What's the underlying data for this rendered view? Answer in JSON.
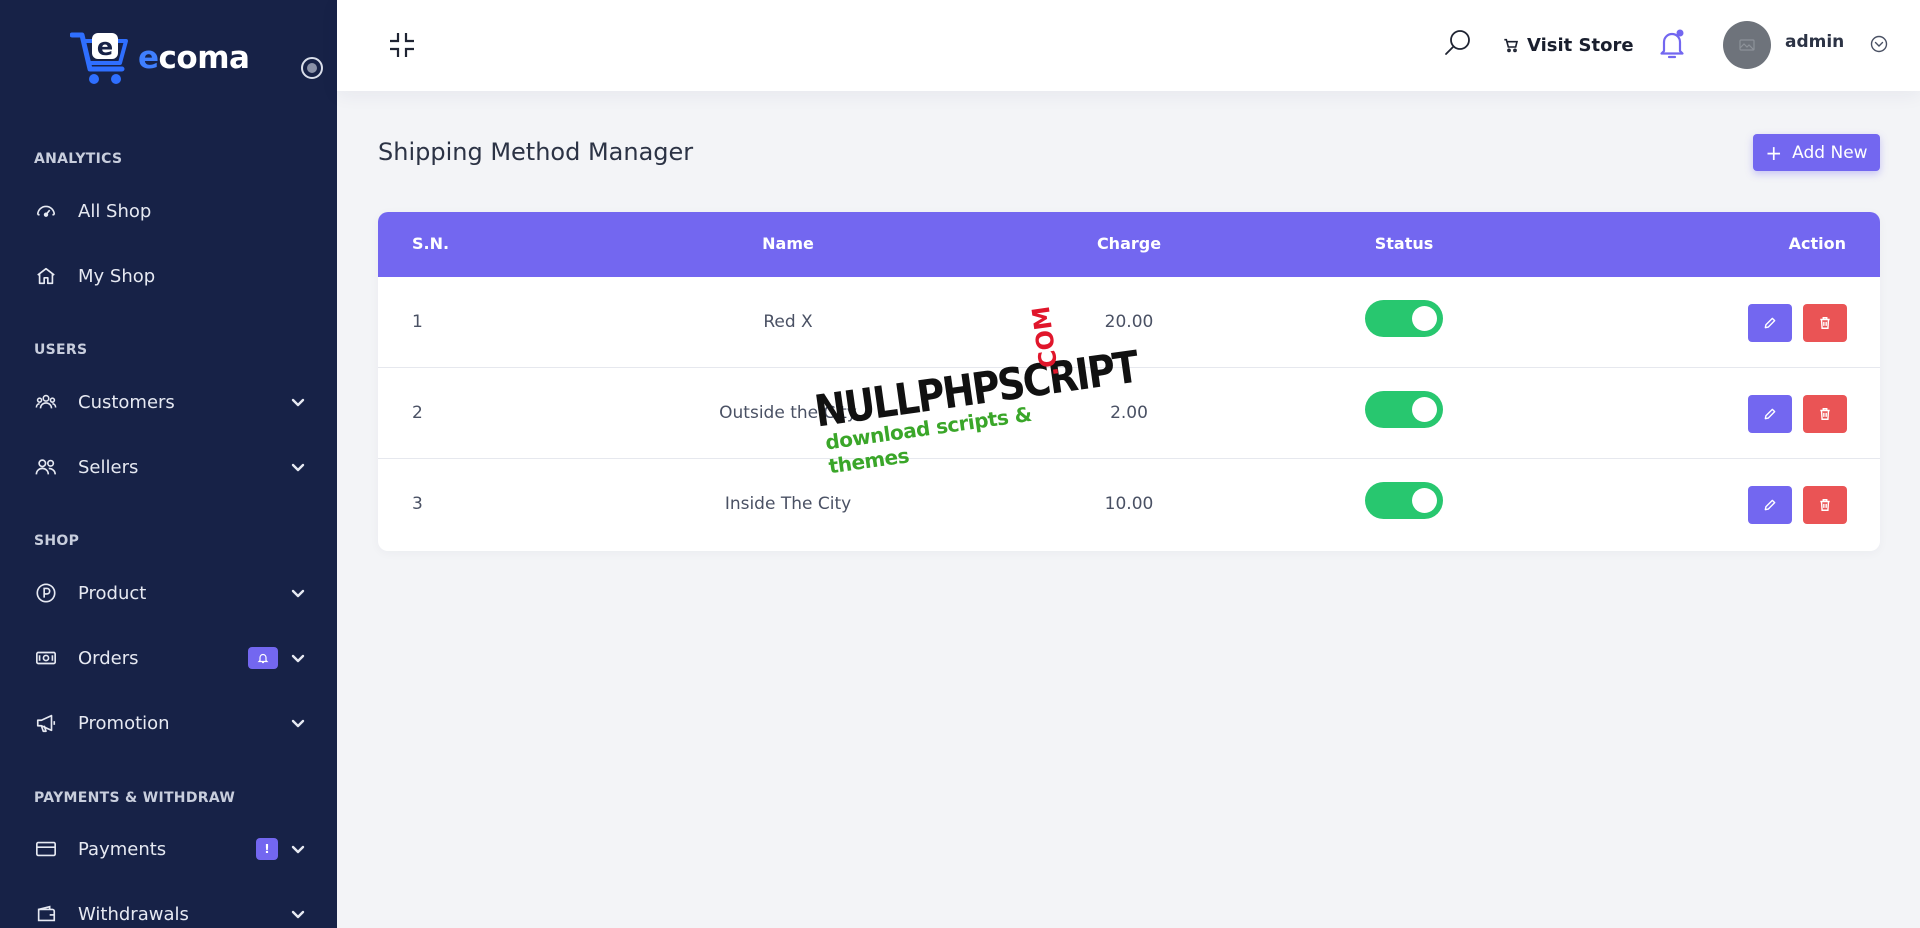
{
  "brand": {
    "logo_text_first": "e",
    "logo_text_rest": "coma",
    "cart_letter": "e"
  },
  "sidebar": {
    "sections": [
      {
        "title": "ANALYTICS"
      },
      {
        "title": "USERS"
      },
      {
        "title": "SHOP"
      },
      {
        "title": "PAYMENTS & WITHDRAW"
      }
    ],
    "items": [
      {
        "label": "All Shop",
        "icon": "dashboard-icon"
      },
      {
        "label": "My Shop",
        "icon": "home-icon"
      },
      {
        "label": "Customers",
        "icon": "users-group-icon"
      },
      {
        "label": "Sellers",
        "icon": "users-icon"
      },
      {
        "label": "Product",
        "icon": "product-icon"
      },
      {
        "label": "Orders",
        "icon": "money-icon",
        "badge": "bell"
      },
      {
        "label": "Promotion",
        "icon": "megaphone-icon"
      },
      {
        "label": "Payments",
        "icon": "card-icon",
        "badge": "!"
      },
      {
        "label": "Withdrawals",
        "icon": "wallet-icon"
      }
    ]
  },
  "header": {
    "visit_store": "Visit Store",
    "user_name": "admin"
  },
  "page": {
    "title": "Shipping Method Manager",
    "add_new": "Add New"
  },
  "table": {
    "columns": [
      "S.N.",
      "Name",
      "Charge",
      "Status",
      "Action"
    ],
    "rows": [
      {
        "sn": "1",
        "name": "Red X",
        "charge": "20.00",
        "status": true
      },
      {
        "sn": "2",
        "name": "Outside the City",
        "charge": "2.00",
        "status": true
      },
      {
        "sn": "3",
        "name": "Inside The City",
        "charge": "10.00",
        "status": true
      }
    ]
  },
  "watermark": {
    "line1": "NULLPHPSCRIPT",
    "com": ".COM",
    "line2": "download scripts & themes"
  },
  "colors": {
    "sidebar_bg": "#172247",
    "accent": "#7367f0",
    "success": "#28c76f",
    "danger": "#ea5455",
    "page_bg": "#f3f4f7"
  }
}
